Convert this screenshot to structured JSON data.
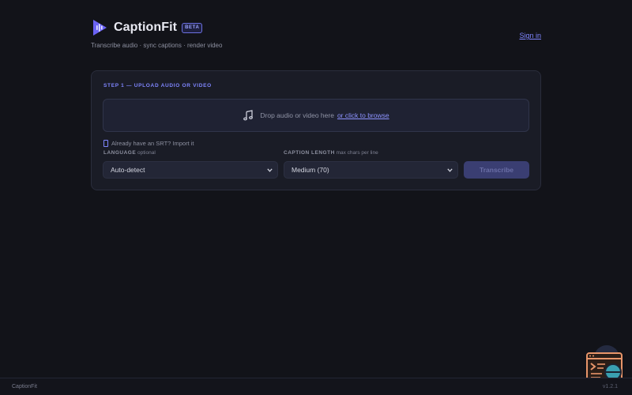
{
  "brand": {
    "name": "CaptionFit",
    "badge": "BETA",
    "tagline": "Transcribe audio · sync captions · render video",
    "logo_icon": "waveform-play-logo"
  },
  "header": {
    "signin_label": "Sign in"
  },
  "step": {
    "title": "STEP 1 — UPLOAD AUDIO OR VIDEO",
    "dropzone": {
      "icon": "music-note-icon",
      "text": "Drop audio or video here",
      "link": "or click to browse"
    },
    "srt_text": "Already have an SRT? Import it"
  },
  "language": {
    "label": "LANGUAGE",
    "hint": "optional",
    "value": "Auto-detect"
  },
  "caption_length": {
    "label": "CAPTION LENGTH",
    "hint": "max chars per line",
    "value": "Medium (70)"
  },
  "transcribe_label": "Transcribe",
  "footer": {
    "text": "CaptionFit",
    "version": "v1.2.1"
  },
  "colors": {
    "accent": "#7f86ff",
    "background": "#121319",
    "card": "#1a1c26",
    "widget": "#e8956a"
  }
}
